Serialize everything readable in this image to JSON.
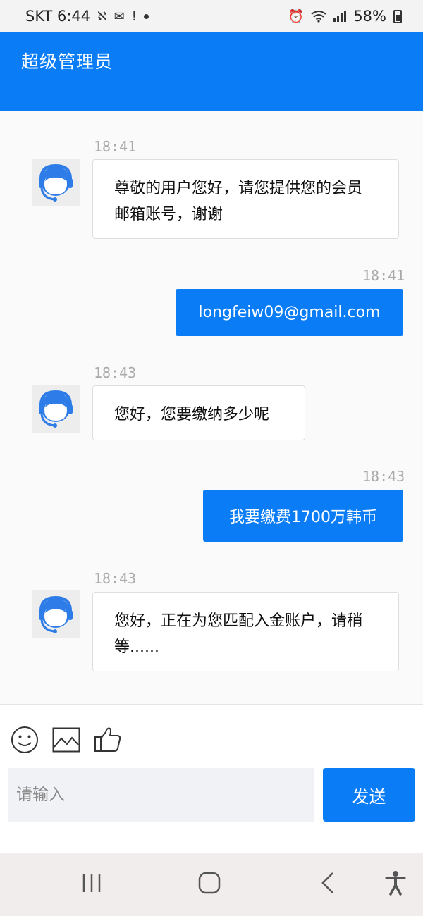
{
  "status_bar": {
    "carrier_time": "SKT 6:44",
    "battery": "58%",
    "icons": [
      "vpn-icon",
      "gmail-icon",
      "notification-icon",
      "dot-icon",
      "alarm-icon",
      "wifi-icon",
      "signal-icon",
      "battery-icon"
    ]
  },
  "header": {
    "title": "超级管理员"
  },
  "messages": [
    {
      "side": "incoming",
      "time": "18:41",
      "text": "尊敬的用户您好，请您提供您的会员邮箱账号，谢谢"
    },
    {
      "side": "outgoing",
      "time": "18:41",
      "text": "longfeiw09@gmail.com"
    },
    {
      "side": "incoming",
      "time": "18:43",
      "text": "您好，您要缴纳多少呢"
    },
    {
      "side": "outgoing",
      "time": "18:43",
      "text": "我要缴费1700万韩币"
    },
    {
      "side": "incoming",
      "time": "18:43",
      "text": "您好，正在为您匹配入金账户，请稍等......"
    }
  ],
  "composer": {
    "tools": [
      "smiley-icon",
      "image-icon",
      "thumbs-up-icon"
    ],
    "placeholder": "请输入",
    "send_label": "发送"
  },
  "nav": {
    "icons": [
      "recent-apps-icon",
      "home-icon",
      "back-icon",
      "accessibility-icon"
    ]
  },
  "colors": {
    "accent": "#0a7cf6",
    "bubble_in_bg": "#ffffff",
    "chat_bg": "#fafafa"
  }
}
